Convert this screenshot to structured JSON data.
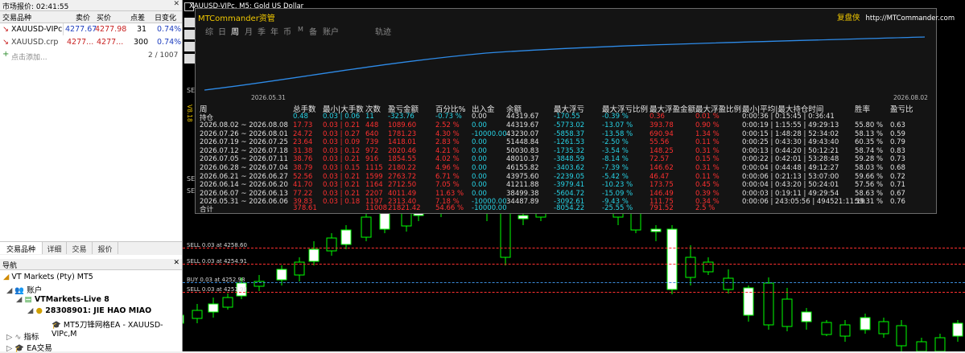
{
  "market_watch": {
    "title": "市场报价: 02:41:55",
    "columns": [
      "交易品种",
      "卖价",
      "买价",
      "点差",
      "日变化"
    ],
    "rows": [
      {
        "symbol": "XAUUSD-VIPc",
        "bid": "4277.67",
        "ask": "4277.98",
        "spread": "31",
        "change": "0.74%"
      },
      {
        "symbol": "XAUUSD.crp",
        "bid": "4277...",
        "ask": "4277...",
        "spread": "300",
        "change": "0.74%"
      }
    ],
    "add_label": "点击添加...",
    "count": "2 / 1007",
    "tabs": [
      "交易品种",
      "详细",
      "交易",
      "报价"
    ]
  },
  "navigator": {
    "title": "导航",
    "broker": "VT Markets (Pty) MT5",
    "accounts_label": "账户",
    "server": "VTMarkets-Live 8",
    "account": "28308901: JIE HAO MIAO",
    "ea": "MT5刀锋网格EA - XAUUSD-VIPc,M",
    "indicators": "指标",
    "ea_trading": "EA交易"
  },
  "chart": {
    "title": "XAUUSD-VIPc, M5:  Gold US Dollar",
    "orders": [
      {
        "label": "SELL 0.03 at 4258.60"
      },
      {
        "label": "SELL 0.03 at 4254.91"
      },
      {
        "label": "BUY 0.03 at 4252.98"
      },
      {
        "label": "SELL 0.03 at 4251.98"
      }
    ],
    "side_labels": [
      "SELL",
      "SELL",
      "SELL"
    ]
  },
  "panel": {
    "title": "MTCommander资管",
    "right_label": "复盘侠",
    "url": "http://MTCommander.com",
    "periods": [
      "综",
      "日",
      "周",
      "月",
      "季",
      "年",
      "币",
      "M",
      "备",
      "账户",
      "轨迹"
    ],
    "active_period": "周",
    "curve_start": "2026.05.31",
    "curve_end": "2026.08.02",
    "side_tag": "V8.18",
    "headers": [
      "周",
      "总手数",
      "最小|大手数",
      "次数",
      "盈亏金额",
      "百分比%",
      "出入金",
      "余额",
      "最大浮亏",
      "最大浮亏比例",
      "最大浮盈金额",
      "最大浮盈比例",
      "最小|平均|最大持仓时间",
      "胜率",
      "盈亏比"
    ],
    "holding": [
      "持仓",
      "0.48",
      "0.03 | 0.06",
      "11",
      "-323.76",
      "-0.73 %",
      "0.00",
      "44319.67",
      "-170.55",
      "-0.39 %",
      "0.36",
      "0.01 %",
      "0:00:36 | 0:15:45 | 0:36:41",
      "",
      ""
    ],
    "rows": [
      [
        "2026.08.02 ~ 2026.08.08",
        "17.73",
        "0.03 | 0.21",
        "448",
        "1089.60",
        "2.52 %",
        "0.00",
        "44319.67",
        "-5773.02",
        "-13.07 %",
        "393.78",
        "0.90 %",
        "0:00:19 | 1:15:55 | 49:29:13",
        "55.80 %",
        "0.63"
      ],
      [
        "2026.07.26 ~ 2026.08.01",
        "24.72",
        "0.03 | 0.27",
        "640",
        "1781.23",
        "4.30 %",
        "-10000.00",
        "43230.07",
        "-5858.37",
        "-13.58 %",
        "690.94",
        "1.34 %",
        "0:00:15 | 1:48:28 | 52:34:02",
        "58.13 %",
        "0.59"
      ],
      [
        "2026.07.19 ~ 2026.07.25",
        "23.64",
        "0.03 | 0.09",
        "739",
        "1418.01",
        "2.83 %",
        "0.00",
        "51448.84",
        "-1261.53",
        "-2.50 %",
        "55.56",
        "0.11 %",
        "0:00:25 | 0:43:30 | 49:43:40",
        "60.35 %",
        "0.79"
      ],
      [
        "2026.07.12 ~ 2026.07.18",
        "31.38",
        "0.03 | 0.12",
        "972",
        "2020.46",
        "4.21 %",
        "0.00",
        "50030.83",
        "-1735.32",
        "-3.54 %",
        "148.25",
        "0.31 %",
        "0:00:13 | 0:44:20 | 50:12:21",
        "58.74 %",
        "0.83"
      ],
      [
        "2026.07.05 ~ 2026.07.11",
        "38.76",
        "0.03 | 0.21",
        "916",
        "1854.55",
        "4.02 %",
        "0.00",
        "48010.37",
        "-3848.59",
        "-8.14 %",
        "72.57",
        "0.15 %",
        "0:00:22 | 0:42:01 | 53:28:48",
        "59.28 %",
        "0.73"
      ],
      [
        "2026.06.28 ~ 2026.07.04",
        "38.79",
        "0.03 | 0.15",
        "1115",
        "2180.22",
        "4.96 %",
        "0.00",
        "46155.82",
        "-3403.62",
        "-7.39 %",
        "146.62",
        "0.31 %",
        "0:00:04 | 0:44:48 | 49:12:27",
        "58.03 %",
        "0.68"
      ],
      [
        "2026.06.21 ~ 2026.06.27",
        "52.56",
        "0.03 | 0.21",
        "1599",
        "2763.72",
        "6.71 %",
        "0.00",
        "43975.60",
        "-2239.05",
        "-5.42 %",
        "46.47",
        "0.11 %",
        "0:00:06 | 0:21:13 | 53:07:00",
        "59.66 %",
        "0.72"
      ],
      [
        "2026.06.14 ~ 2026.06.20",
        "41.70",
        "0.03 | 0.21",
        "1164",
        "2712.50",
        "7.05 %",
        "0.00",
        "41211.88",
        "-3979.41",
        "-10.23 %",
        "173.75",
        "0.45 %",
        "0:00:04 | 0:43:20 | 50:24:01",
        "57.56 %",
        "0.71"
      ],
      [
        "2026.06.07 ~ 2026.06.13",
        "77.22",
        "0.03 | 0.21",
        "2207",
        "4011.49",
        "11.63 %",
        "0.00",
        "38499.38",
        "-5604.72",
        "-15.09 %",
        "146.49",
        "0.39 %",
        "0:00:03 | 0:19:11 | 49:29:54",
        "58.63 %",
        "0.67"
      ],
      [
        "2026.05.31 ~ 2026.06.06",
        "39.83",
        "0.03 | 0.18",
        "1197",
        "2313.40",
        "7.18 %",
        "-10000.00",
        "34487.89",
        "-3092.61",
        "-9.43 %",
        "111.75",
        "0.34 %",
        "0:00:06 | 243:05:56 | 494521:11:19",
        "59.31 %",
        "0.76"
      ]
    ],
    "total": [
      "合计",
      "378.61",
      "",
      "11008",
      "21821.42",
      "54.66 %",
      "-10000.00",
      "",
      "-8054.22",
      "-25.55 %",
      "791.52",
      "2.5 %",
      "",
      "",
      ""
    ]
  },
  "colors": {
    "profit": "#ff3030",
    "neutral": "#27d3e6",
    "title": "#f0c800",
    "curve": "#2e8be8",
    "candle": "#00ff00"
  }
}
